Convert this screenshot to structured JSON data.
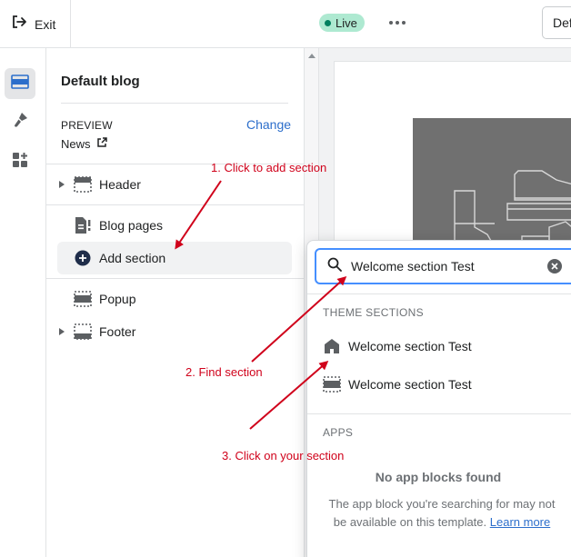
{
  "topbar": {
    "exit_label": "Exit",
    "status_label": "Live",
    "default_button_label": "Default"
  },
  "rail": {
    "items": [
      "sections-icon",
      "theme-settings-icon",
      "app-embeds-icon"
    ]
  },
  "sidebar": {
    "title": "Default blog",
    "preview": {
      "label": "PREVIEW",
      "change_label": "Change",
      "value": "News"
    },
    "items": {
      "header": "Header",
      "blog_pages": "Blog pages",
      "add_section": "Add section",
      "popup": "Popup",
      "footer": "Footer"
    }
  },
  "popover": {
    "search_value": "Welcome section Test",
    "theme_sections_heading": "THEME SECTIONS",
    "theme_sections": [
      "Welcome section Test",
      "Welcome section Test"
    ],
    "apps_heading": "APPS",
    "no_apps_title": "No app blocks found",
    "no_apps_text": "The app block you're searching for may not be available on this template.",
    "learn_more": "Learn more"
  },
  "annotations": {
    "step1": "1. Click to add section",
    "step2": "2. Find section",
    "step3": "3. Click on your section"
  },
  "colors": {
    "accent": "#2c6ecb",
    "live_badge": "#aee9d1",
    "annotation": "#d0021b",
    "focus_ring": "#458fff"
  }
}
